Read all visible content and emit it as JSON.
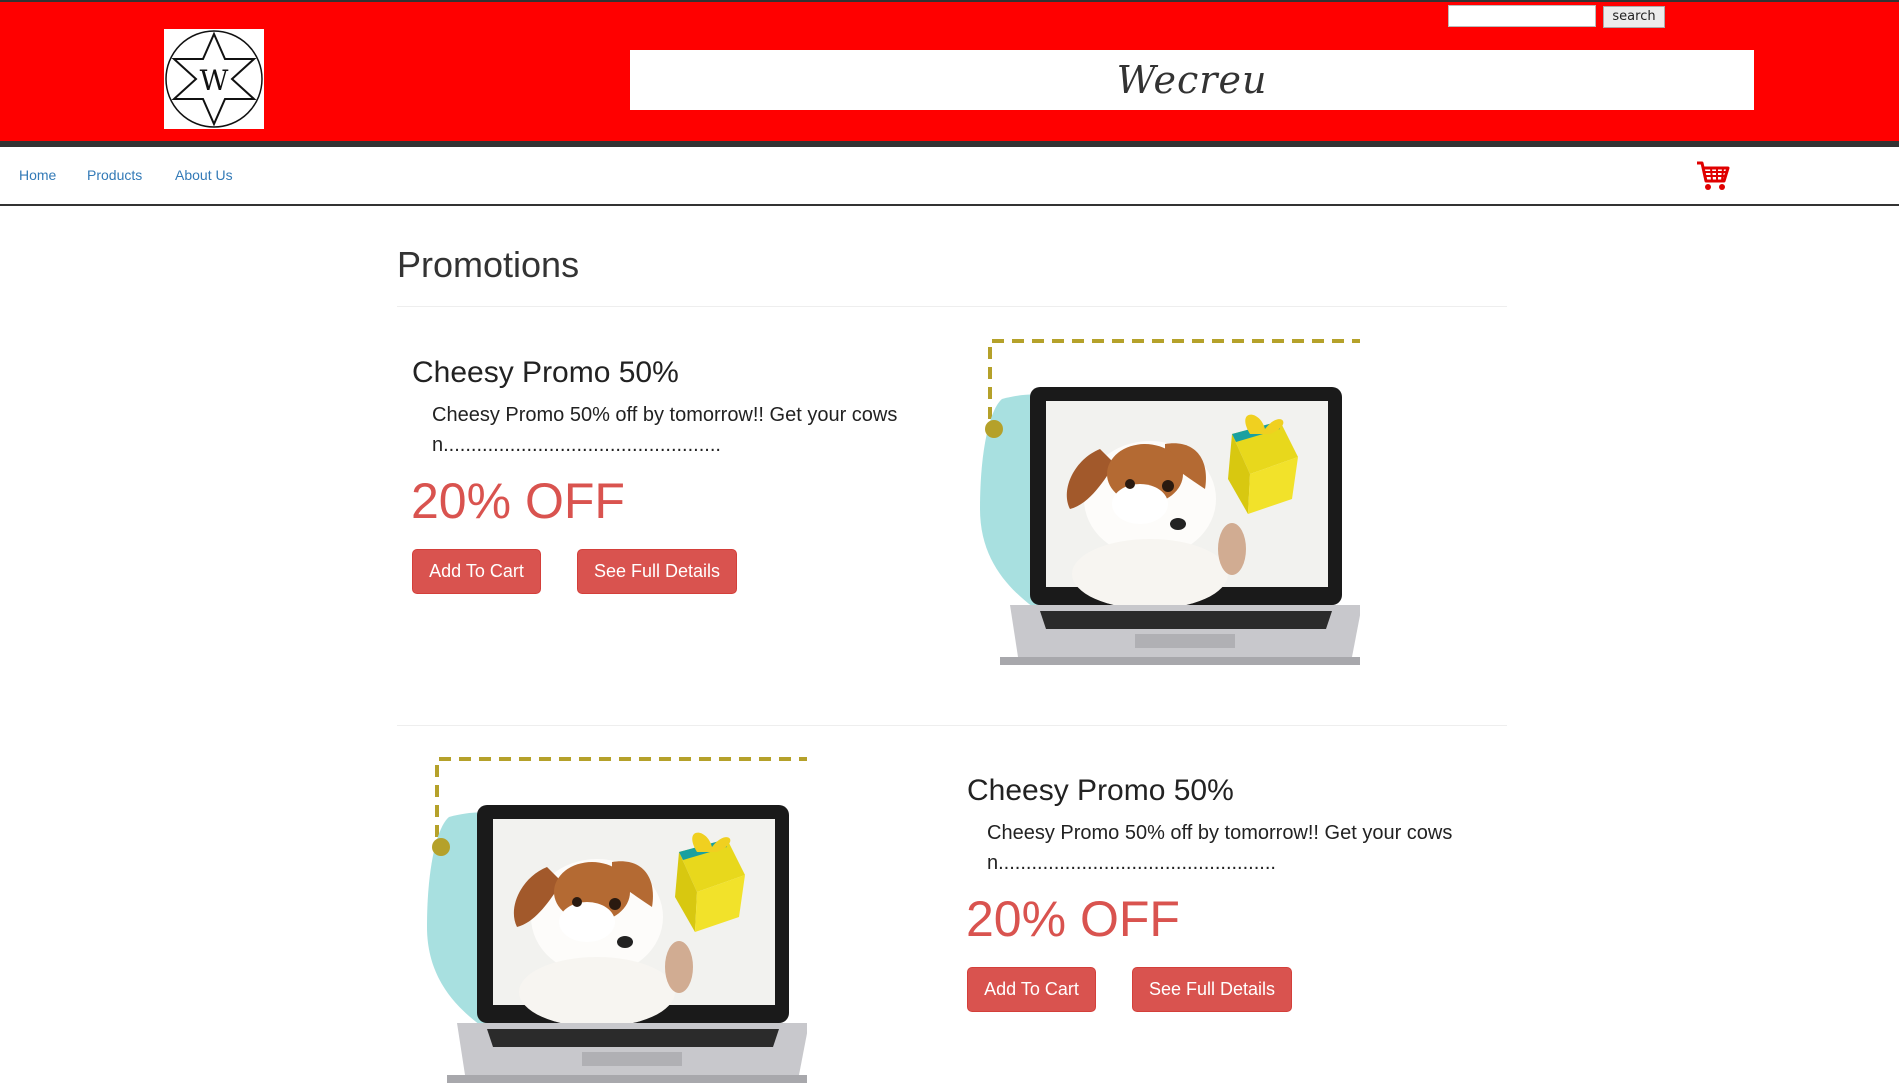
{
  "header": {
    "brand": "Wecreu",
    "logo_letter": "W",
    "search_placeholder": "",
    "search_button": "search",
    "bg_color": "#ff0000"
  },
  "nav": {
    "items": [
      {
        "label": "Home"
      },
      {
        "label": "Products"
      },
      {
        "label": "About Us"
      }
    ],
    "cart_icon": "shopping-cart-icon"
  },
  "page": {
    "title": "Promotions"
  },
  "promos": [
    {
      "title": "Cheesy Promo 50%",
      "description": "Cheesy Promo 50% off by tomorrow!! Get your cows n..................................................",
      "discount": "20% OFF",
      "add_to_cart": "Add To Cart",
      "details": "See Full Details",
      "image": "laptop-dog-gift-image"
    },
    {
      "title": "Cheesy Promo 50%",
      "description": "Cheesy Promo 50% off by tomorrow!! Get your cows n..................................................",
      "discount": "20% OFF",
      "add_to_cart": "Add To Cart",
      "details": "See Full Details",
      "image": "laptop-dog-gift-image"
    }
  ],
  "colors": {
    "accent": "#d9534f",
    "link": "#337ab7",
    "dashed_line": "#b5a12a",
    "teal_blob": "#a8e0e0"
  }
}
